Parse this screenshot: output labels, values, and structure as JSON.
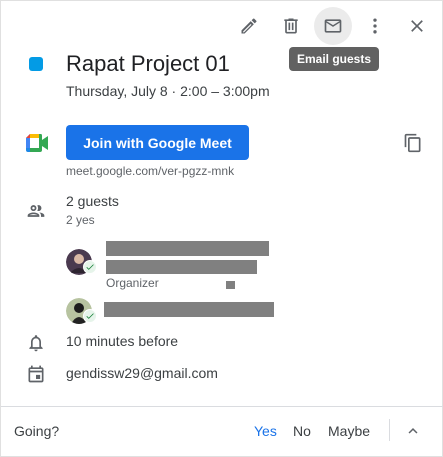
{
  "toolbar": {
    "edit_icon": "pencil-icon",
    "delete_icon": "trash-icon",
    "email_icon": "mail-icon",
    "more_icon": "more-vertical-icon",
    "close_icon": "close-icon",
    "tooltip": "Email guests"
  },
  "event": {
    "color": "#039be5",
    "title": "Rapat Project 01",
    "datetime": "Thursday, July 8  ·  2:00 – 3:00pm"
  },
  "meet": {
    "button_label": "Join with Google Meet",
    "link": "meet.google.com/ver-pgzz-mnk",
    "accent": "#1a73e8"
  },
  "guests": {
    "count": "2 guests",
    "summary": "2 yes",
    "organizer_label": "Organizer"
  },
  "reminder": "10 minutes before",
  "calendar_owner": "gendissw29@gmail.com",
  "footer": {
    "going": "Going?",
    "yes": "Yes",
    "no": "No",
    "maybe": "Maybe"
  }
}
